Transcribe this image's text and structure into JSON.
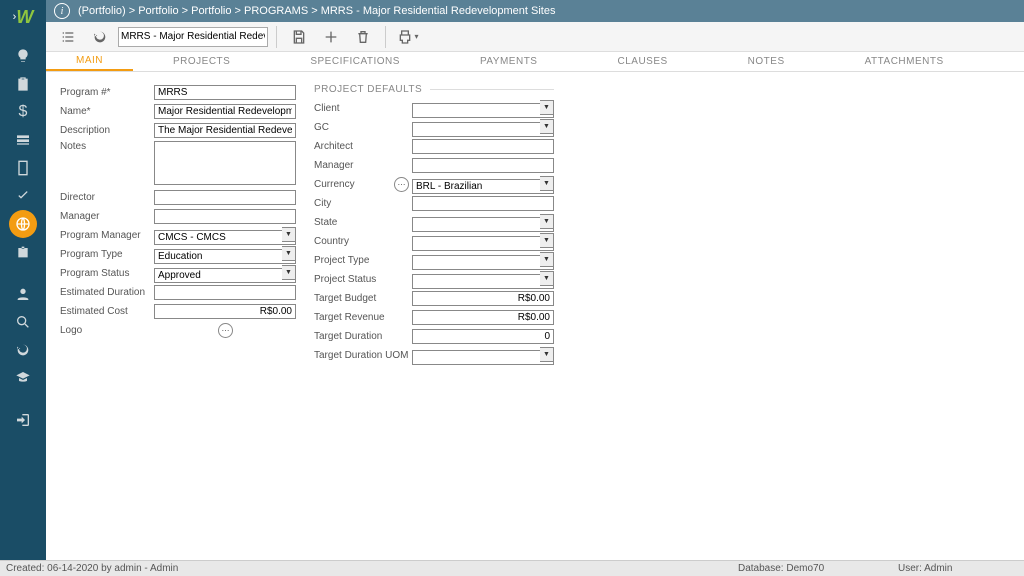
{
  "breadcrumb": "(Portfolio) > Portfolio > Portfolio > PROGRAMS > MRRS - Major Residential Redevelopment Sites",
  "toolbar": {
    "record_select": "MRRS - Major Residential Redevelop…"
  },
  "tabs": [
    "MAIN",
    "PROJECTS",
    "SPECIFICATIONS",
    "PAYMENTS",
    "CLAUSES",
    "NOTES",
    "ATTACHMENTS"
  ],
  "active_tab": 0,
  "left": {
    "program_no_label": "Program #*",
    "program_no": "MRRS",
    "name_label": "Name*",
    "name": "Major Residential Redevelopment Sites",
    "description_label": "Description",
    "description": "The Major Residential Redevelopment Si",
    "notes_label": "Notes",
    "notes": "",
    "director_label": "Director",
    "director": "",
    "manager_label": "Manager",
    "manager": "",
    "program_manager_label": "Program Manager",
    "program_manager": "CMCS - CMCS",
    "program_type_label": "Program Type",
    "program_type": "Education",
    "program_status_label": "Program Status",
    "program_status": "Approved",
    "est_duration_label": "Estimated Duration",
    "est_duration": "",
    "est_cost_label": "Estimated Cost",
    "est_cost": "R$0.00",
    "logo_label": "Logo"
  },
  "right": {
    "section": "PROJECT DEFAULTS",
    "client_label": "Client",
    "client": "",
    "gc_label": "GC",
    "gc": "",
    "architect_label": "Architect",
    "architect": "",
    "manager_label": "Manager",
    "manager": "",
    "currency_label": "Currency",
    "currency": "BRL - Brazilian",
    "city_label": "City",
    "city": "",
    "state_label": "State",
    "state": "",
    "country_label": "Country",
    "country": "",
    "project_type_label": "Project Type",
    "project_type": "",
    "project_status_label": "Project Status",
    "project_status": "",
    "target_budget_label": "Target Budget",
    "target_budget": "R$0.00",
    "target_revenue_label": "Target Revenue",
    "target_revenue": "R$0.00",
    "target_duration_label": "Target Duration",
    "target_duration": "0",
    "target_duration_uom_label": "Target Duration UOM",
    "target_duration_uom": ""
  },
  "statusbar": {
    "created": "Created:   06-14-2020 by admin - Admin",
    "database": "Database:   Demo70",
    "user": "User:   Admin"
  }
}
